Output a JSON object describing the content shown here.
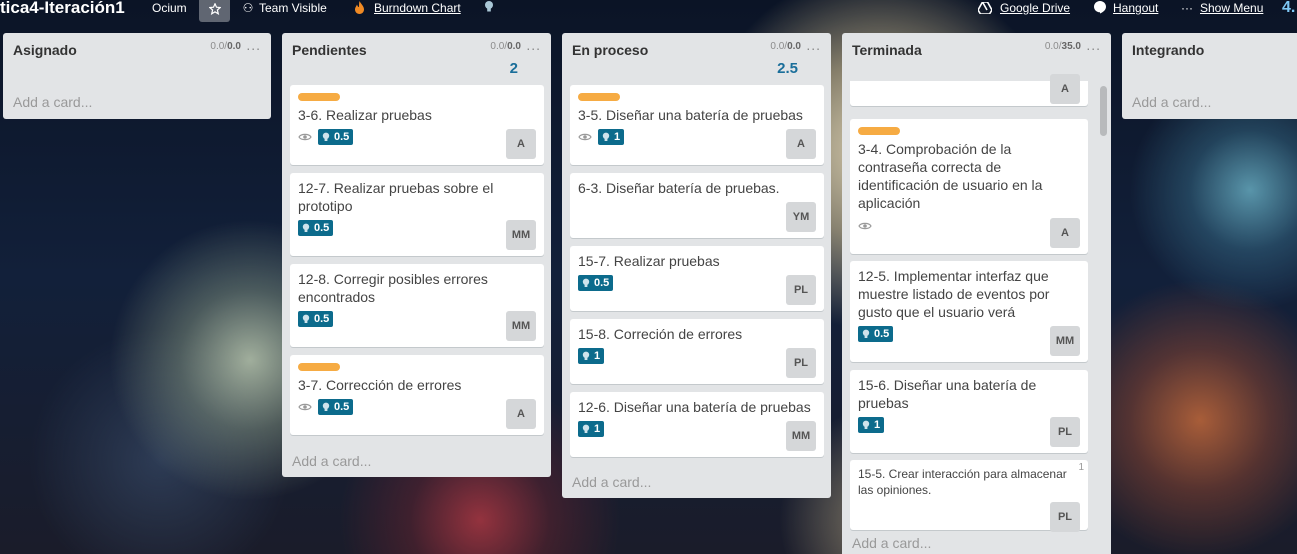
{
  "header": {
    "board_title": "tica4-Iteración1",
    "org": "Ocium",
    "visibility": "Team Visible",
    "burndown": "Burndown Chart",
    "google_drive": "Google Drive",
    "hangout": "Hangout",
    "show_menu": "Show Menu",
    "trailing_number": "4."
  },
  "icons": {
    "star": "star-icon",
    "team": "team-icon",
    "flame": "flame-icon",
    "bulb": "lightbulb-icon",
    "drive": "google-drive-icon",
    "hangout": "hangout-icon",
    "more": "more-icon",
    "eye": "eye-icon"
  },
  "colors": {
    "list_bg": "#e2e4e6",
    "label_orange": "#f6ab43",
    "points_badge": "#0c6b8c",
    "total_blue": "#1a6e9a"
  },
  "list_menu": "...",
  "add_card": "Add a card...",
  "lists": [
    {
      "name": "Asignado",
      "points_a": "0.0/",
      "points_b": "0.0",
      "total": ""
    },
    {
      "name": "Pendientes",
      "points_a": "0.0/",
      "points_b": "0.0",
      "total": "2"
    },
    {
      "name": "En proceso",
      "points_a": "0.0/",
      "points_b": "0.0",
      "total": "2.5"
    },
    {
      "name": "Terminada",
      "points_a": "0.0/",
      "points_b": "35.0",
      "total": ""
    },
    {
      "name": "Integrando"
    }
  ],
  "cards": {
    "pendientes": [
      {
        "title": "3-6. Realizar pruebas",
        "points": "0.5",
        "member": "A"
      },
      {
        "title": "12-7. Realizar pruebas sobre el prototipo",
        "points": "0.5",
        "member": "MM"
      },
      {
        "title": "12-8. Corregir posibles errores encontrados",
        "points": "0.5",
        "member": "MM"
      },
      {
        "title": "3-7. Corrección de errores",
        "points": "0.5",
        "member": "A"
      }
    ],
    "en_proceso": [
      {
        "title": "3-5. Diseñar una batería de pruebas",
        "points": "1",
        "member": "A"
      },
      {
        "title": "6-3. Diseñar batería de pruebas.",
        "member": "YM"
      },
      {
        "title": "15-7. Realizar pruebas",
        "points": "0.5",
        "member": "PL"
      },
      {
        "title": "15-8. Correción de errores",
        "points": "1",
        "member": "PL"
      },
      {
        "title": "12-6. Diseñar una batería de pruebas",
        "points": "1",
        "member": "MM"
      }
    ],
    "terminada": [
      {
        "member": "A"
      },
      {
        "title": "3-4. Comprobación de la contraseña correcta de identificación de usuario en la aplicación",
        "member": "A"
      },
      {
        "title": "12-5. Implementar interfaz que muestre listado de eventos por gusto que el usuario verá",
        "points": "0.5",
        "member": "MM"
      },
      {
        "title": "15-6. Diseñar una batería de pruebas",
        "points": "1",
        "member": "PL"
      },
      {
        "title": "15-5. Crear interacción para almacenar las opiniones.",
        "corner": "1",
        "member": "PL"
      }
    ]
  }
}
